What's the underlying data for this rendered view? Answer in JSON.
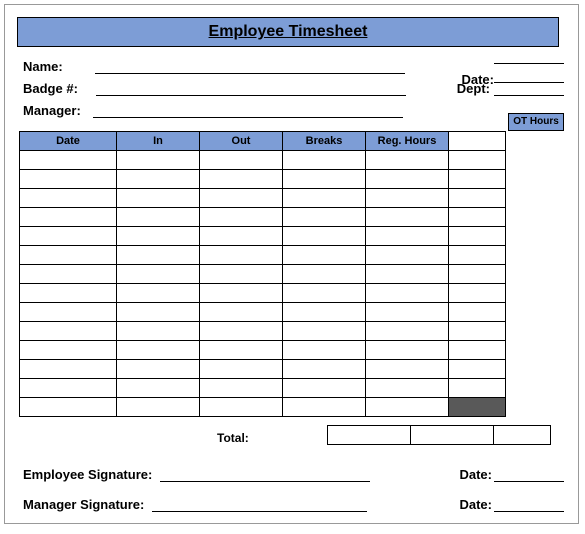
{
  "title": "Employee Timesheet",
  "labels": {
    "name": "Name:",
    "badge": "Badge #:",
    "manager": "Manager:",
    "date": "Date:",
    "dept": "Dept:",
    "ot_hours": "OT Hours",
    "total": "Total:",
    "emp_sig": "Employee Signature:",
    "mgr_sig": "Manager Signature:"
  },
  "columns": {
    "date": "Date",
    "in": "In",
    "out": "Out",
    "breaks": "Breaks",
    "reg": "Reg. Hours"
  },
  "values": {
    "name": "",
    "badge": "",
    "manager": "",
    "date_top": "",
    "dept": "",
    "total_breaks": "",
    "total_reg": "",
    "total_ot": "",
    "emp_sig": "",
    "emp_sig_date": "",
    "mgr_sig": "",
    "mgr_sig_date": ""
  },
  "rows": [
    {
      "date": "",
      "in": "",
      "out": "",
      "breaks": "",
      "reg": "",
      "ot": ""
    },
    {
      "date": "",
      "in": "",
      "out": "",
      "breaks": "",
      "reg": "",
      "ot": ""
    },
    {
      "date": "",
      "in": "",
      "out": "",
      "breaks": "",
      "reg": "",
      "ot": ""
    },
    {
      "date": "",
      "in": "",
      "out": "",
      "breaks": "",
      "reg": "",
      "ot": ""
    },
    {
      "date": "",
      "in": "",
      "out": "",
      "breaks": "",
      "reg": "",
      "ot": ""
    },
    {
      "date": "",
      "in": "",
      "out": "",
      "breaks": "",
      "reg": "",
      "ot": ""
    },
    {
      "date": "",
      "in": "",
      "out": "",
      "breaks": "",
      "reg": "",
      "ot": ""
    },
    {
      "date": "",
      "in": "",
      "out": "",
      "breaks": "",
      "reg": "",
      "ot": ""
    },
    {
      "date": "",
      "in": "",
      "out": "",
      "breaks": "",
      "reg": "",
      "ot": ""
    },
    {
      "date": "",
      "in": "",
      "out": "",
      "breaks": "",
      "reg": "",
      "ot": ""
    },
    {
      "date": "",
      "in": "",
      "out": "",
      "breaks": "",
      "reg": "",
      "ot": ""
    },
    {
      "date": "",
      "in": "",
      "out": "",
      "breaks": "",
      "reg": "",
      "ot": ""
    },
    {
      "date": "",
      "in": "",
      "out": "",
      "breaks": "",
      "reg": "",
      "ot": ""
    },
    {
      "date": "",
      "in": "",
      "out": "",
      "breaks": "",
      "reg": "",
      "ot": ""
    }
  ]
}
